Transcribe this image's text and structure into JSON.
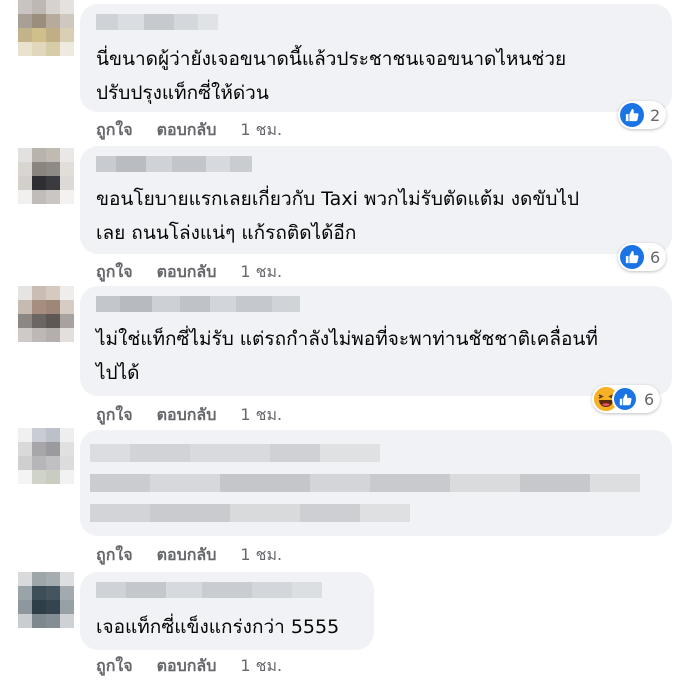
{
  "comments": [
    {
      "text": "นี่ขนาดผู้ว่ายังเจอขนาดนี้แล้วประชาชนเจอขนาดไหนช่วย\nปรับปรุงแท็กซี่ให้ด่วน",
      "like_label": "ถูกใจ",
      "reply_label": "ตอบกลับ",
      "time": "1 ชม.",
      "reaction_count": "2",
      "reactions": [
        "like-icon"
      ]
    },
    {
      "text": "ขอนโยบายแรกเลยเกี่ยวกับ Taxi พวกไม่รับตัดแต้ม งดขับไป\nเลย ถนนโล่งแน่ๆ แก้รถติดได้อีก",
      "like_label": "ถูกใจ",
      "reply_label": "ตอบกลับ",
      "time": "1 ชม.",
      "reaction_count": "6",
      "reactions": [
        "like-icon"
      ]
    },
    {
      "text": "ไม่ใช่แท็กซี่ไม่รับ แต่รถกำลังไม่พอที่จะพาท่านชัชชาติเคลื่อนที่\nไปได้",
      "like_label": "ถูกใจ",
      "reply_label": "ตอบกลับ",
      "time": "1 ชม.",
      "reaction_count": "6",
      "reactions": [
        "haha-icon",
        "like-icon"
      ]
    },
    {
      "text": "",
      "like_label": "ถูกใจ",
      "reply_label": "ตอบกลับ",
      "time": "1 ชม."
    },
    {
      "text": "เจอแท็กซี่แข็งแกร่งกว่า 5555",
      "like_label": "ถูกใจ",
      "reply_label": "ตอบกลับ",
      "time": "1 ชม."
    }
  ],
  "colors": {
    "bubble": "#f0f2f5",
    "meta_text": "#65676b",
    "like_blue": "#1b74e4",
    "haha_yellow": "#f7b125"
  }
}
